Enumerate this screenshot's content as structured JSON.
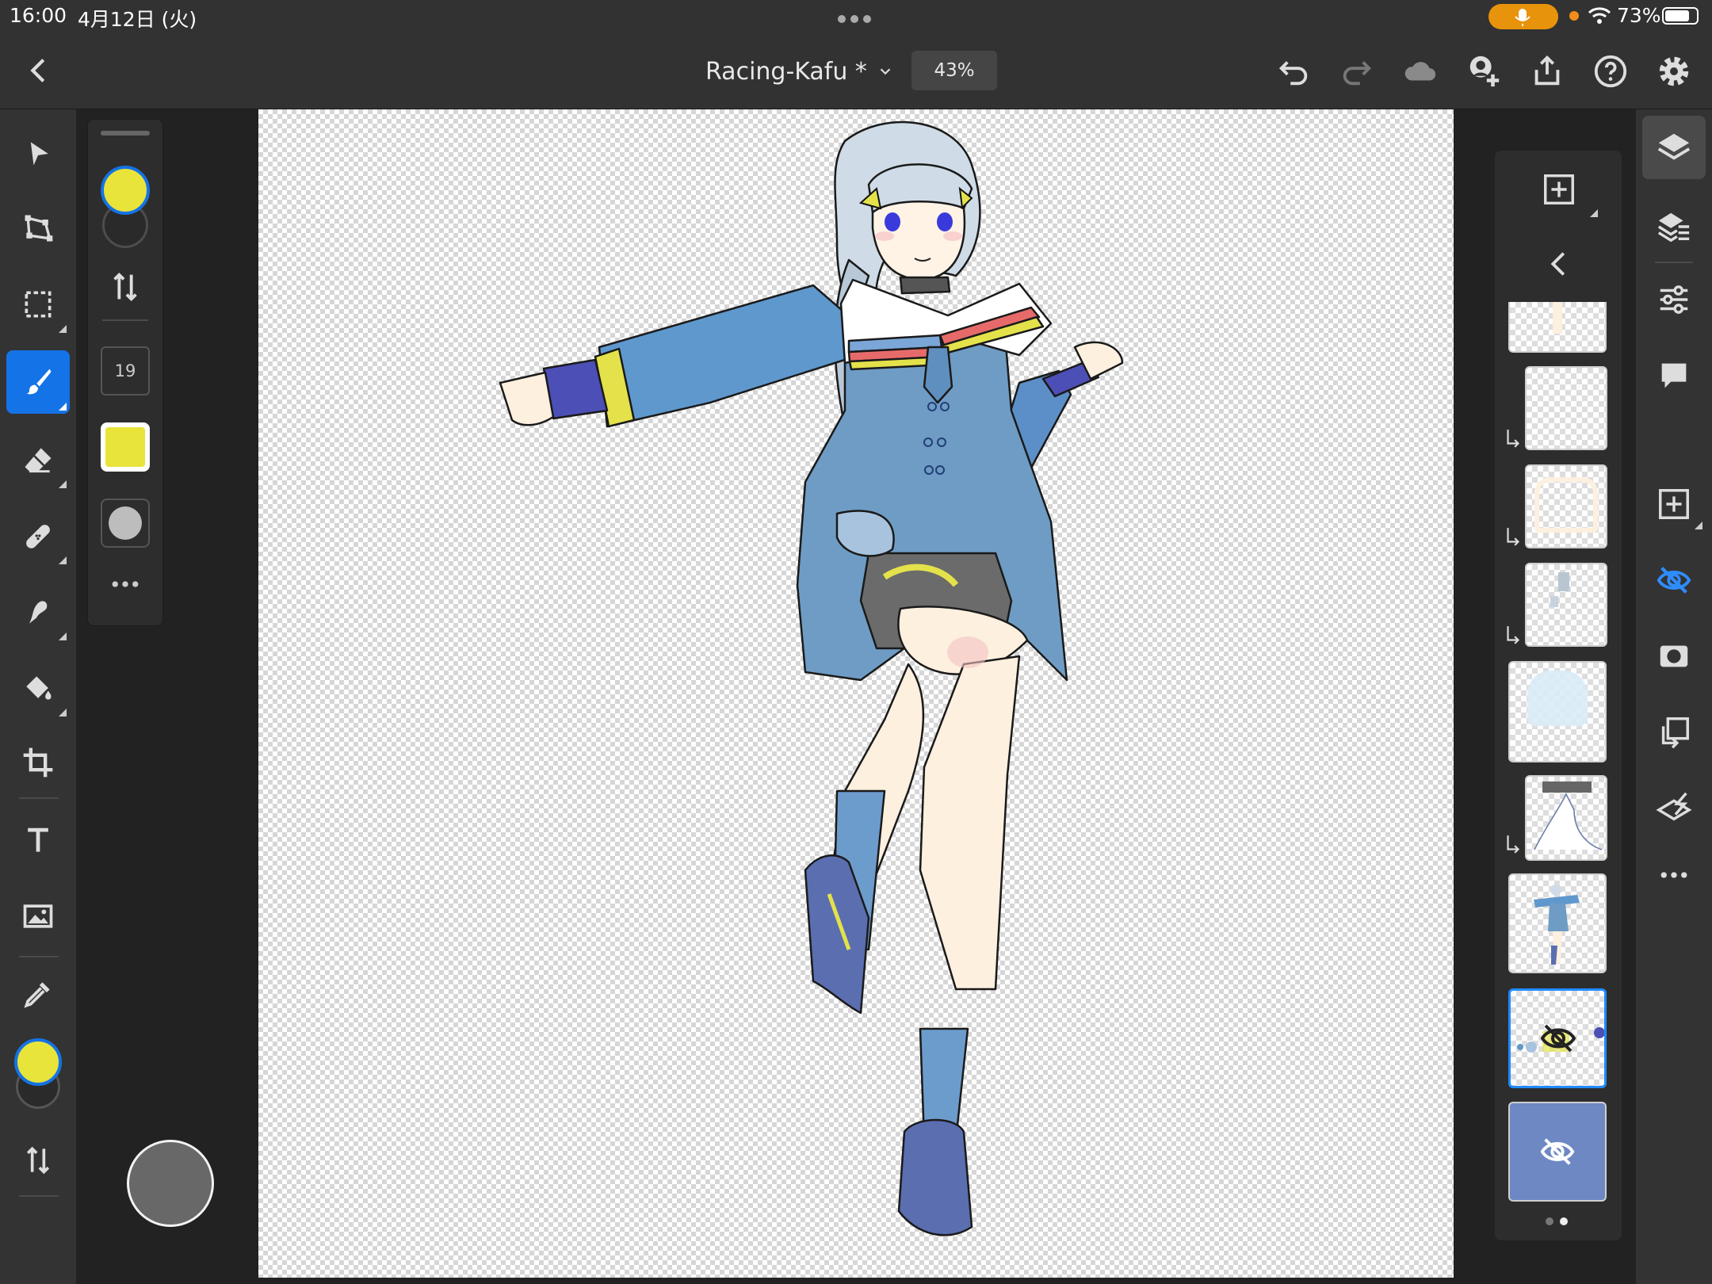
{
  "status_bar": {
    "time": "16:00",
    "date": "4月12日 (火)",
    "battery": "73%"
  },
  "document": {
    "title": "Racing-Kafu *",
    "zoom": "43%"
  },
  "tool_options": {
    "brush_size": "19",
    "colors": {
      "primary": "#e8e43a",
      "secondary": "#2a2a2a",
      "accent": "#1473e6"
    }
  },
  "tools": [
    "select-tool",
    "transform-tool",
    "marquee-tool",
    "brush-tool",
    "eraser-tool",
    "healing-tool",
    "smudge-tool",
    "fill-tool",
    "crop-tool",
    "type-tool",
    "place-image-tool",
    "eyedropper-tool"
  ],
  "layers": {
    "page_indicator": [
      "page-1",
      "page-2"
    ],
    "selected_index": 7,
    "hidden_layers": [
      7,
      8
    ]
  }
}
